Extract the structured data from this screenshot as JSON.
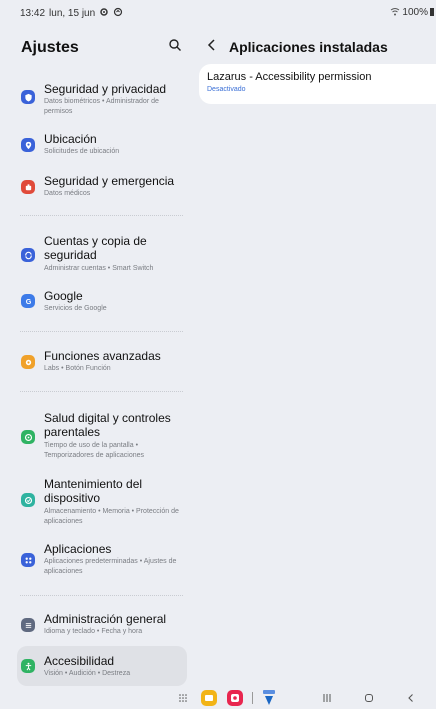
{
  "status_bar": {
    "time": "13:42",
    "date": "lun, 15 jun",
    "battery": "100%"
  },
  "left_panel": {
    "title": "Ajustes",
    "items": [
      {
        "title": "Seguridad y privacidad",
        "subtitle": "Datos biométricos • Administrador de permisos",
        "icon": "shield-icon",
        "color": "#3a62d9"
      },
      {
        "title": "Ubicación",
        "subtitle": "Solicitudes de ubicación",
        "icon": "location-pin-icon",
        "color": "#3a62d9"
      },
      {
        "title": "Seguridad y emergencia",
        "subtitle": "Datos médicos",
        "icon": "emergency-icon",
        "color": "#e04a3a"
      },
      {
        "title": "Cuentas y copia de seguridad",
        "subtitle": "Administrar cuentas • Smart Switch",
        "icon": "sync-icon",
        "color": "#3a62d9"
      },
      {
        "title": "Google",
        "subtitle": "Servicios de Google",
        "icon": "google-icon",
        "color": "#3d7be8"
      },
      {
        "title": "Funciones avanzadas",
        "subtitle": "Labs • Botón Función",
        "icon": "gear-plus-icon",
        "color": "#f0a12a"
      },
      {
        "title": "Salud digital y controles parentales",
        "subtitle": "Tiempo de uso de la pantalla • Temporizadores de aplicaciones",
        "icon": "digital-wellbeing-icon",
        "color": "#2fb363"
      },
      {
        "title": "Mantenimiento del dispositivo",
        "subtitle": "Almacenamiento • Memoria • Protección de aplicaciones",
        "icon": "device-care-icon",
        "color": "#2fb3a0"
      },
      {
        "title": "Aplicaciones",
        "subtitle": "Aplicaciones predeterminadas • Ajustes de aplicaciones",
        "icon": "apps-grid-icon",
        "color": "#3a62d9"
      },
      {
        "title": "Administración general",
        "subtitle": "Idioma y teclado • Fecha y hora",
        "icon": "sliders-icon",
        "color": "#606a80"
      },
      {
        "title": "Accesibilidad",
        "subtitle": "Visión • Audición • Destreza",
        "icon": "accessibility-icon",
        "color": "#2fb363"
      }
    ]
  },
  "right_panel": {
    "title": "Aplicaciones instaladas",
    "apps": [
      {
        "name": "Lazarus - Accessibility permission",
        "status": "Desactivado"
      }
    ]
  }
}
